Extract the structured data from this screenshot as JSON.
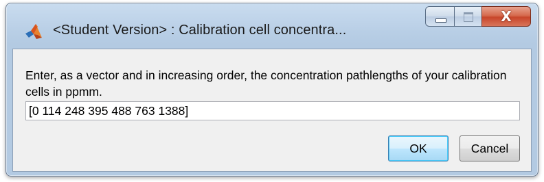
{
  "window": {
    "title": "<Student Version> : Calibration cell concentra...",
    "app_icon": "matlab-logo-icon"
  },
  "caption_buttons": {
    "minimize_icon": "minimize-icon",
    "maximize_icon": "maximize-icon",
    "close_icon": "close-icon",
    "close_glyph": "X"
  },
  "dialog": {
    "prompt": "Enter, as a vector and in increasing order, the concentration pathlengths of your calibration cells in ppmm.",
    "input_value": "[0 114 248 395 488 763 1388]",
    "ok_label": "OK",
    "cancel_label": "Cancel"
  },
  "colors": {
    "frame": "#b9cfe6",
    "client_bg": "#f0f0f0",
    "close_button": "#c8462a",
    "default_button_border": "#3c7fb1"
  }
}
